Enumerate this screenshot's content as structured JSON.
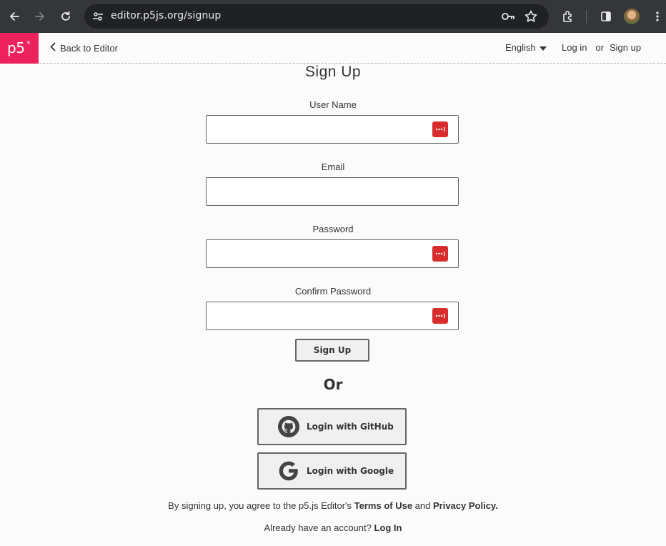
{
  "browser": {
    "url": "editor.p5js.org/signup"
  },
  "header": {
    "logo_text": "p5",
    "logo_star": "*",
    "back_label": "Back to Editor",
    "language": "English",
    "login_label": "Log in",
    "or_label": "or",
    "signup_label": "Sign up"
  },
  "form": {
    "title": "Sign Up",
    "username_label": "User Name",
    "username_value": "",
    "email_label": "Email",
    "email_value": "",
    "password_label": "Password",
    "password_value": "",
    "confirm_label": "Confirm Password",
    "confirm_value": "",
    "submit_label": "Sign Up",
    "or_text": "Or",
    "github_label": "Login with GitHub",
    "google_label": "Login with Google"
  },
  "footer": {
    "terms_prefix": "By signing up, you agree to the p5.js Editor's ",
    "terms_link": "Terms of Use",
    "terms_and": " and ",
    "privacy_link": "Privacy Policy.",
    "have_account": "Already have an account? ",
    "login_link": "Log In"
  },
  "colors": {
    "brand": "#ed225d",
    "password_manager": "#d92d2d",
    "chrome_bg": "#35363a",
    "omnibox_bg": "#202124"
  },
  "icons": {
    "browser": [
      "back-arrow-icon",
      "forward-arrow-icon",
      "reload-icon",
      "site-settings-icon",
      "key-icon",
      "star-icon",
      "extensions-icon",
      "side-panel-icon",
      "profile-avatar",
      "more-menu-icon"
    ],
    "header": [
      "chevron-left-icon",
      "dropdown-triangle-icon"
    ],
    "form": [
      "password-manager-icon",
      "github-icon",
      "google-icon"
    ]
  }
}
